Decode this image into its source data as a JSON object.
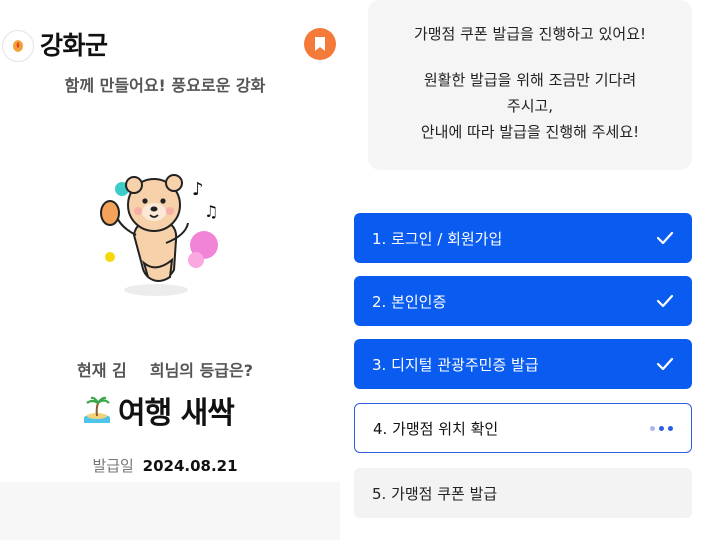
{
  "header": {
    "region": "강화군",
    "slogan": "함께 만들어요! 풍요로운 강화"
  },
  "grade": {
    "prefix": "현재 김",
    "suffix": "희님의 등급은?",
    "name": "여행 새싹"
  },
  "issue": {
    "label": "발급일",
    "date": "2024.08.21"
  },
  "notice": {
    "line1": "가맹점 쿠폰 발급을 진행하고 있어요!",
    "line2": "원활한 발급을 위해 조금만 기다려",
    "line3": "주시고,",
    "line4": "안내에 따라 발급을 진행해 주세요!"
  },
  "steps": [
    {
      "label": "1. 로그인 / 회원가입",
      "status": "done"
    },
    {
      "label": "2. 본인인증",
      "status": "done"
    },
    {
      "label": "3. 디지털 관광주민증 발급",
      "status": "done"
    },
    {
      "label": "4. 가맹점 위치 확인",
      "status": "in-progress"
    },
    {
      "label": "5. 가맹점 쿠폰 발급",
      "status": "pending"
    }
  ],
  "colors": {
    "accent": "#0a5cf0",
    "bookmark": "#f47a3a",
    "current_border": "#2e5ee0"
  }
}
